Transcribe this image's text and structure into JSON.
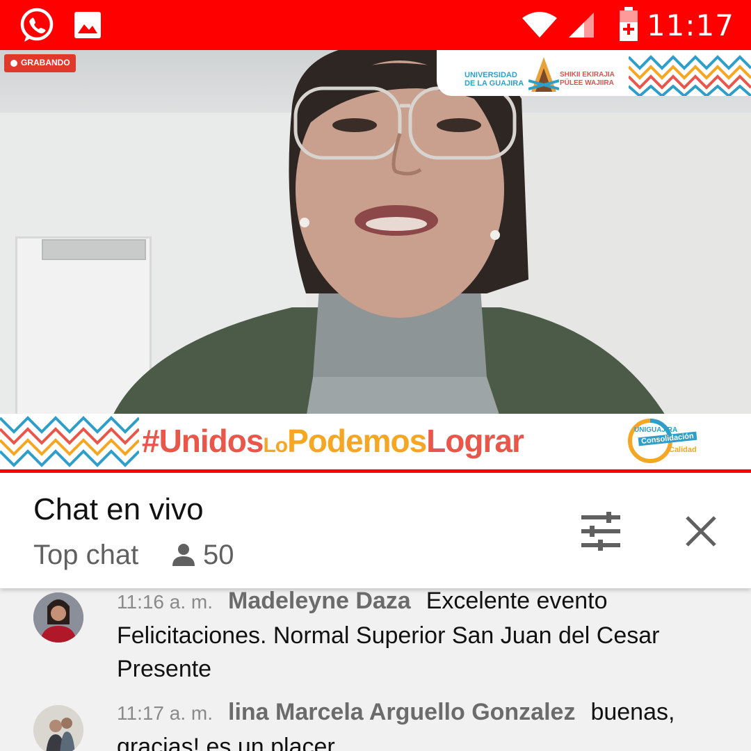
{
  "status_bar": {
    "time": "11:17",
    "icons": [
      "whatsapp-icon",
      "image-icon",
      "wifi-icon",
      "signal-icon",
      "battery-charging-icon"
    ],
    "background": "#fe0000"
  },
  "video": {
    "recording_badge": "GRABANDO",
    "university_name": "UNIVERSIDAD DE LA GUAJIRA",
    "wayuu_motto": "SHIKII EKIRAJIA PÜLEE WAJIIRA",
    "hashtag_part1": "#Unidos",
    "hashtag_part2": "Lo",
    "hashtag_part3": "Podemos",
    "hashtag_part4": "Lograr",
    "campaign_brand": "UNIGUAJIRA",
    "campaign_text1": "Consolidación",
    "campaign_text2": "Calidad"
  },
  "chat": {
    "title": "Chat en vivo",
    "mode": "Top chat",
    "viewers": "50",
    "messages": [
      {
        "time": "11:16 a. m.",
        "author": "Madeleyne Daza",
        "text": "Excelente evento Felicitaciones. Normal Superior San Juan del Cesar Presente"
      },
      {
        "time": "11:17 a. m.",
        "author": "lina Marcela Arguello Gonzalez",
        "text": "buenas, gracias! es un placer"
      }
    ]
  },
  "colors": {
    "accent_red": "#ff0000",
    "hashtag_orange": "#e8574a",
    "hashtag_yellow": "#f5a623",
    "uni_blue": "#2f9ec9"
  }
}
